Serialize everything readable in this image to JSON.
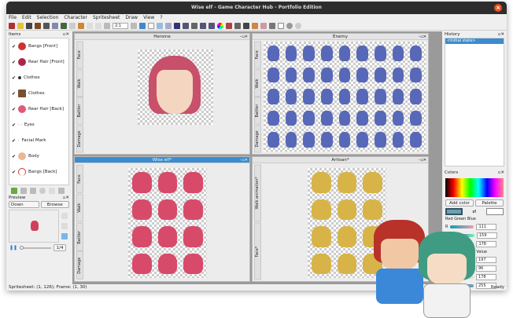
{
  "window": {
    "title": "Wise elf - Game Character Hub - Portfolio Edition",
    "close": "×"
  },
  "menu": [
    "File",
    "Edit",
    "Selection",
    "Character",
    "Spritesheet",
    "Draw",
    "View",
    "?"
  ],
  "toolbar": {
    "zoom": "2:1"
  },
  "items_panel": {
    "title": "Items",
    "items": [
      "Bangs [Front]",
      "Rear Hair [Front]",
      "Clothes",
      "Clothes",
      "Rear Hair [Back]",
      "Eyes",
      "Facial Mark",
      "Body",
      "Bangs [Back]"
    ]
  },
  "preview": {
    "title": "Preview",
    "direction": "Down",
    "browse": "Browse",
    "frame": "1/4"
  },
  "status": {
    "left": "Spritesheet: (1, 126); Frame: (1, 30)",
    "right": "Ready"
  },
  "subwindows": [
    {
      "title": "Heroine",
      "tabs": [
        "Face",
        "Walk",
        "Battler",
        "Damage"
      ]
    },
    {
      "title": "Enemy",
      "tabs": [
        "Face",
        "Walk",
        "Battler",
        "Damage"
      ]
    },
    {
      "title": "Wise elf*",
      "tabs": [
        "Face",
        "Walk",
        "Battler",
        "Damage"
      ]
    },
    {
      "title": "Artisan*",
      "tabs": [
        "Walk animation*",
        "Face*"
      ]
    }
  ],
  "history": {
    "title": "History",
    "items": [
      "<Initial state>"
    ]
  },
  "colors": {
    "title": "Colors",
    "add": "Add color",
    "palette": "Palette",
    "swap": "⇄",
    "rgb_label": "Red Green Blue",
    "hsv_label": "Hue Saturation Value",
    "r": "111",
    "g": "159",
    "b": "178",
    "h": "197",
    "s": "96",
    "v": "178",
    "a": "255",
    "labels": [
      "R",
      "G",
      "B"
    ],
    "current": "#6f9fb2"
  }
}
